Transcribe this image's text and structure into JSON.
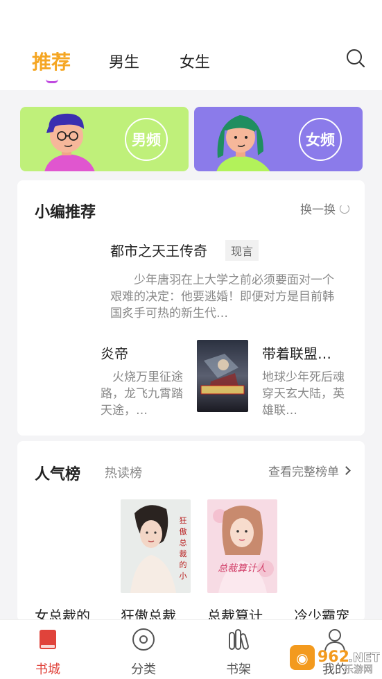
{
  "tabs": [
    {
      "label": "推荐",
      "active": true
    },
    {
      "label": "男生",
      "active": false
    },
    {
      "label": "女生",
      "active": false
    }
  ],
  "banners": {
    "male_label": "男频",
    "female_label": "女频",
    "male_color": "#bff07a",
    "female_color": "#8b7bea"
  },
  "editor": {
    "title": "小编推荐",
    "refresh_label": "换一换",
    "featured": {
      "title": "都市之天王传奇",
      "tag": "现言",
      "desc": "少年唐羽在上大学之前必须要面对一个艰难的决定：他要逃婚！即便对方是目前韩国炙手可热的新生代…"
    },
    "books": [
      {
        "title": "炎帝",
        "desc": "火烧万里征途路，龙飞九霄踏天途，…"
      },
      {
        "title": "带着联盟…",
        "desc": "地球少年死后魂穿天玄大陆，英雄联…",
        "cover_text": "带着联盟英雄去修仙"
      }
    ]
  },
  "ranking": {
    "title": "人气榜",
    "subtitle": "热读榜",
    "more_label": "查看完整榜单",
    "books": [
      {
        "title": "女总裁的"
      },
      {
        "title": "狂傲总裁",
        "cover_text": "狂傲总裁的小丽"
      },
      {
        "title": "总裁算计",
        "cover_text": "总裁算计人"
      },
      {
        "title": "冷少霸宠"
      }
    ]
  },
  "bottom_nav": [
    {
      "label": "书城",
      "active": true
    },
    {
      "label": "分类",
      "active": false
    },
    {
      "label": "书架",
      "active": false
    },
    {
      "label": "我的",
      "active": false
    }
  ],
  "watermark": {
    "main": "962.NET",
    "sub": "乐游网"
  },
  "colors": {
    "accent": "#f5a623",
    "nav_active": "#e0433b"
  }
}
